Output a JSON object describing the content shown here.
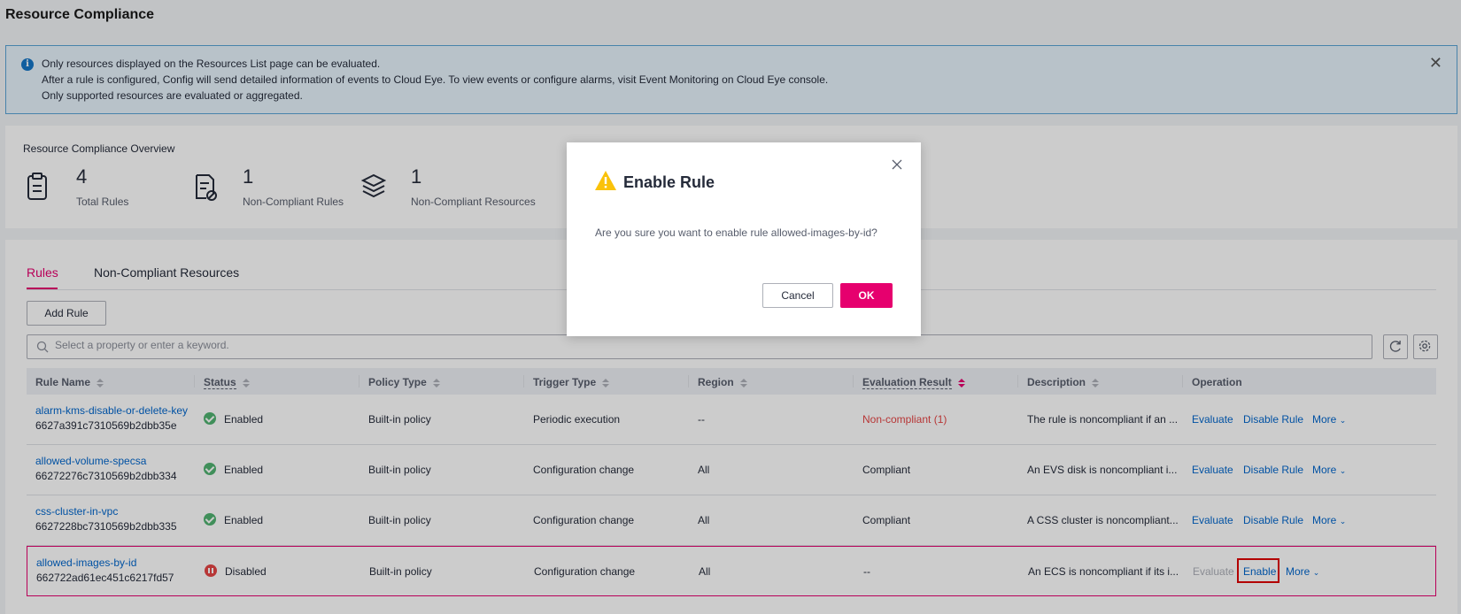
{
  "page": {
    "title": "Resource Compliance"
  },
  "alert": {
    "lines": [
      "Only resources displayed on the Resources List page can be evaluated.",
      "After a rule is configured, Config will send detailed information of events to Cloud Eye. To view events or configure alarms, visit Event Monitoring on Cloud Eye console.",
      "Only supported resources are evaluated or aggregated."
    ],
    "close_glyph": "✕"
  },
  "overview": {
    "title": "Resource Compliance Overview",
    "stats": [
      {
        "value": "4",
        "label": "Total Rules",
        "icon": "clipboard-icon"
      },
      {
        "value": "1",
        "label": "Non-Compliant Rules",
        "icon": "noncompliant-doc-icon"
      },
      {
        "value": "1",
        "label": "Non-Compliant Resources",
        "icon": "cube-stack-icon"
      }
    ]
  },
  "tabs": [
    {
      "label": "Rules",
      "active": true
    },
    {
      "label": "Non-Compliant Resources",
      "active": false
    }
  ],
  "toolbar": {
    "add_rule_label": "Add Rule"
  },
  "search": {
    "placeholder": "Select a property or enter a keyword."
  },
  "table": {
    "headers": {
      "rule_name": "Rule Name",
      "status": "Status",
      "policy_type": "Policy Type",
      "trigger_type": "Trigger Type",
      "region": "Region",
      "evaluation_result": "Evaluation Result",
      "description": "Description",
      "operation": "Operation"
    },
    "rows": [
      {
        "name": "alarm-kms-disable-or-delete-key",
        "id": "6627a391c7310569b2dbb35e",
        "status": "Enabled",
        "policy_type": "Built-in policy",
        "trigger_type": "Periodic execution",
        "region": "--",
        "evaluation_result": "Non-compliant (1)",
        "description": "The rule is noncompliant if an ...",
        "op1": "Evaluate",
        "op2": "Disable Rule",
        "op3": "More"
      },
      {
        "name": "allowed-volume-specsa",
        "id": "66272276c7310569b2dbb334",
        "status": "Enabled",
        "policy_type": "Built-in policy",
        "trigger_type": "Configuration change",
        "region": "All",
        "evaluation_result": "Compliant",
        "description": "An EVS disk is noncompliant i...",
        "op1": "Evaluate",
        "op2": "Disable Rule",
        "op3": "More"
      },
      {
        "name": "css-cluster-in-vpc",
        "id": "6627228bc7310569b2dbb335",
        "status": "Enabled",
        "policy_type": "Built-in policy",
        "trigger_type": "Configuration change",
        "region": "All",
        "evaluation_result": "Compliant",
        "description": "A CSS cluster is noncompliant...",
        "op1": "Evaluate",
        "op2": "Disable Rule",
        "op3": "More"
      },
      {
        "name": "allowed-images-by-id",
        "id": "662722ad61ec451c6217fd57",
        "status": "Disabled",
        "policy_type": "Built-in policy",
        "trigger_type": "Configuration change",
        "region": "All",
        "evaluation_result": "--",
        "description": "An ECS is noncompliant if its i...",
        "op1": "Evaluate",
        "op2": "Enable",
        "op3": "More"
      }
    ]
  },
  "modal": {
    "title": "Enable Rule",
    "message": "Are you sure you want to enable rule allowed-images-by-id?",
    "cancel_label": "Cancel",
    "ok_label": "OK"
  },
  "colors": {
    "accent": "#e6006e",
    "link": "#0066cc",
    "error": "#e54545",
    "success": "#50b371"
  }
}
